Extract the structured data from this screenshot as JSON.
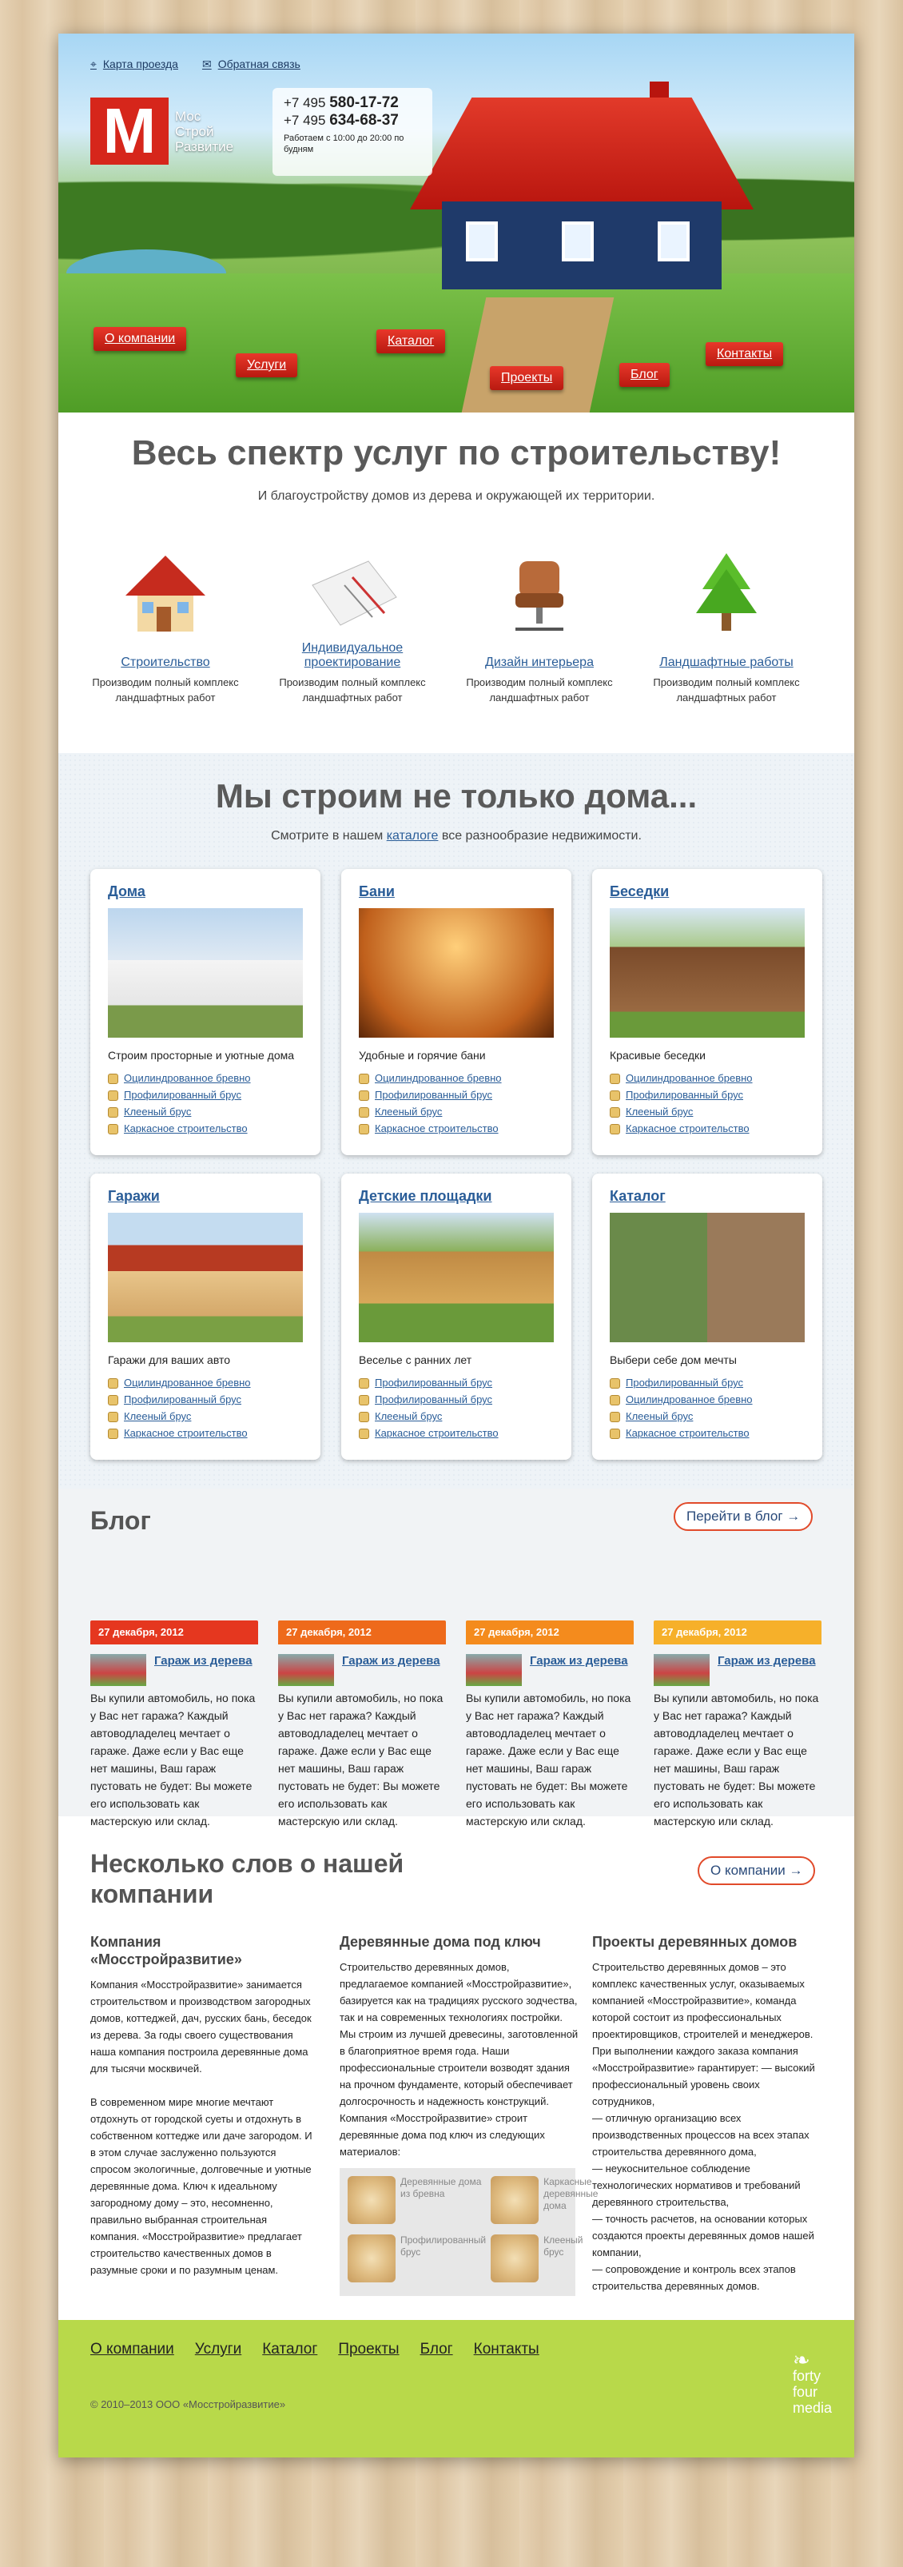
{
  "header": {
    "map_link": "Карта проезда",
    "feedback_link": "Обратная связь",
    "logo_letter": "M",
    "logo_lines": [
      "Мос",
      "Строй",
      "Развитие"
    ],
    "phones": [
      {
        "code": "+7 495",
        "num": "580-17-72"
      },
      {
        "code": "+7 495",
        "num": "634-68-37"
      }
    ],
    "hours": "Работаем с 10:00 до 20:00 по будням"
  },
  "nav": [
    "О компании",
    "Услуги",
    "Каталог",
    "Проекты",
    "Блог",
    "Контакты"
  ],
  "services": {
    "title": "Весь спектр услуг по строительству!",
    "subtitle": "И благоустройству домов из дерева и окружающей их территории.",
    "items": [
      {
        "title": "Строительство",
        "desc": "Производим полный комплекс ландшафтных работ"
      },
      {
        "title": "Индивидуальное проектирование",
        "desc": "Производим полный комплекс ландшафтных работ"
      },
      {
        "title": "Дизайн интерьера",
        "desc": "Производим полный комплекс ландшафтных работ"
      },
      {
        "title": "Ландшафтные работы",
        "desc": "Производим полный комплекс ландшафтных работ"
      }
    ]
  },
  "build": {
    "title": "Мы строим не только дома...",
    "sub_pre": "Смотрите в нашем ",
    "sub_link": "каталоге",
    "sub_post": " все разнообразие недвижимости.",
    "cards": [
      {
        "title": "Дома",
        "desc": "Строим просторные и уютные дома",
        "links": [
          "Оцилиндрованное бревно",
          "Профилированный брус",
          "Клееный брус",
          "Каркасное строительство"
        ]
      },
      {
        "title": "Бани",
        "desc": "Удобные и горячие бани",
        "links": [
          "Оцилиндрованное бревно",
          "Профилированный брус",
          "Клееный брус",
          "Каркасное строительство"
        ]
      },
      {
        "title": "Беседки",
        "desc": "Красивые беседки",
        "links": [
          "Оцилиндрованное бревно",
          "Профилированный брус",
          "Клееный брус",
          "Каркасное строительство"
        ]
      },
      {
        "title": "Гаражи",
        "desc": "Гаражи для ваших авто",
        "links": [
          "Оцилиндрованное бревно",
          "Профилированный брус",
          "Клееный брус",
          "Каркасное строительство"
        ]
      },
      {
        "title": "Детские площадки",
        "desc": "Веселье с ранних лет",
        "links": [
          "Профилированный брус",
          "Профилированный брус",
          "Клееный брус",
          "Каркасное строительство"
        ]
      },
      {
        "title": "Каталог",
        "desc": "Выбери себе дом мечты",
        "links": [
          "Профилированный брус",
          "Оцилиндрованное бревно",
          "Клееный брус",
          "Каркасное строительство"
        ]
      }
    ]
  },
  "blog": {
    "title": "Блог",
    "button": "Перейти в блог →",
    "posts": [
      {
        "date": "27 декабря, 2012",
        "title": "Гараж из дерева",
        "text": "Вы купили автомобиль, но пока у Вас нет гаража? Каждый автоводладелец мечтает о гараже. Даже если у Вас еще нет машины, Ваш гараж пустовать не будет: Вы можете его использовать как мастерскую или склад.",
        "color": "#e5371f"
      },
      {
        "date": "27 декабря, 2012",
        "title": "Гараж из дерева",
        "text": "Вы купили автомобиль, но пока у Вас нет гаража? Каждый автоводладелец мечтает о гараже. Даже если у Вас еще нет машины, Ваш гараж пустовать не будет: Вы можете его использовать как мастерскую или склад.",
        "color": "#ee6a1b"
      },
      {
        "date": "27 декабря, 2012",
        "title": "Гараж из дерева",
        "text": "Вы купили автомобиль, но пока у Вас нет гаража? Каждый автоводладелец мечтает о гараже. Даже если у Вас еще нет машины, Ваш гараж пустовать не будет: Вы можете его использовать как мастерскую или склад.",
        "color": "#f48b1d"
      },
      {
        "date": "27 декабря, 2012",
        "title": "Гараж из дерева",
        "text": "Вы купили автомобиль, но пока у Вас нет гаража? Каждый автоводладелец мечтает о гараже. Даже если у Вас еще нет машины, Ваш гараж пустовать не будет: Вы можете его использовать как мастерскую или склад.",
        "color": "#f6b02a"
      }
    ]
  },
  "about": {
    "title": "Несколько слов о нашей компании",
    "button": "О компании →",
    "cols": [
      {
        "title": "Компания «Мосстройразвитие»",
        "text": "Компания «Мосстройразвитие» занимается строительством и производством загородных домов, коттеджей, дач, русских бань, беседок из дерева. За годы своего существования наша компания построила деревянные дома для тысячи москвичей.\n\nВ современном мире многие мечтают отдохнуть от городской суеты и отдохнуть в собственном коттедже или даче загородом. И в этом случае заслуженно пользуются спросом экологичные, долговечные и уютные деревянные дома. Ключ к идеальному загородному дому – это, несомненно, правильно выбранная строительная компания. «Мосстройразвитие» предлагает строительство качественных домов в разумные сроки и по разумным ценам."
      },
      {
        "title": "Деревянные дома под ключ",
        "text": "Строительство деревянных домов, предлагаемое компанией «Мосстройразвитие», базируется как на традициях русского зодчества, так и на современных технологиях постройки. Мы строим из лучшей древесины, заготовленной в благоприятное время года. Наши профессиональные строители возводят здания на прочном фундаменте, который обеспечивает долгосрочность и надежность конструкций. Компания «Мосстройразвитие» строит деревянные дома под ключ из следующих материалов:"
      },
      {
        "title": "Проекты деревянных домов",
        "text": "Строительство деревянных домов – это комплекс качественных услуг, оказываемых компанией «Мосстройразвитие», команда которой состоит из профессиональных проектировщиков, строителей и менеджеров. При выполнении каждого заказа компания «Мосстройразвитие» гарантирует: — высокий профессиональный уровень своих сотрудников,\n— отличную организацию всех производственных процессов на всех этапах строительства деревянного дома,\n— неукоснительное соблюдение технологических нормативов и требований деревянного строительства,\n— точность расчетов, на основании которых создаются проекты деревянных домов нашей компании,\n— сопровождение и контроль всех этапов строительства деревянных домов."
      }
    ],
    "materials": [
      "Деревянные дома из бревна",
      "Каркасные деревянные дома",
      "Профилированный брус",
      "Клееный брус"
    ]
  },
  "footer": {
    "nav": [
      "О компании",
      "Услуги",
      "Каталог",
      "Проекты",
      "Блог",
      "Контакты"
    ],
    "copyright": "© 2010–2013 ООО «Мосстройразвитие»",
    "brand": [
      "forty",
      "four",
      "media"
    ]
  }
}
